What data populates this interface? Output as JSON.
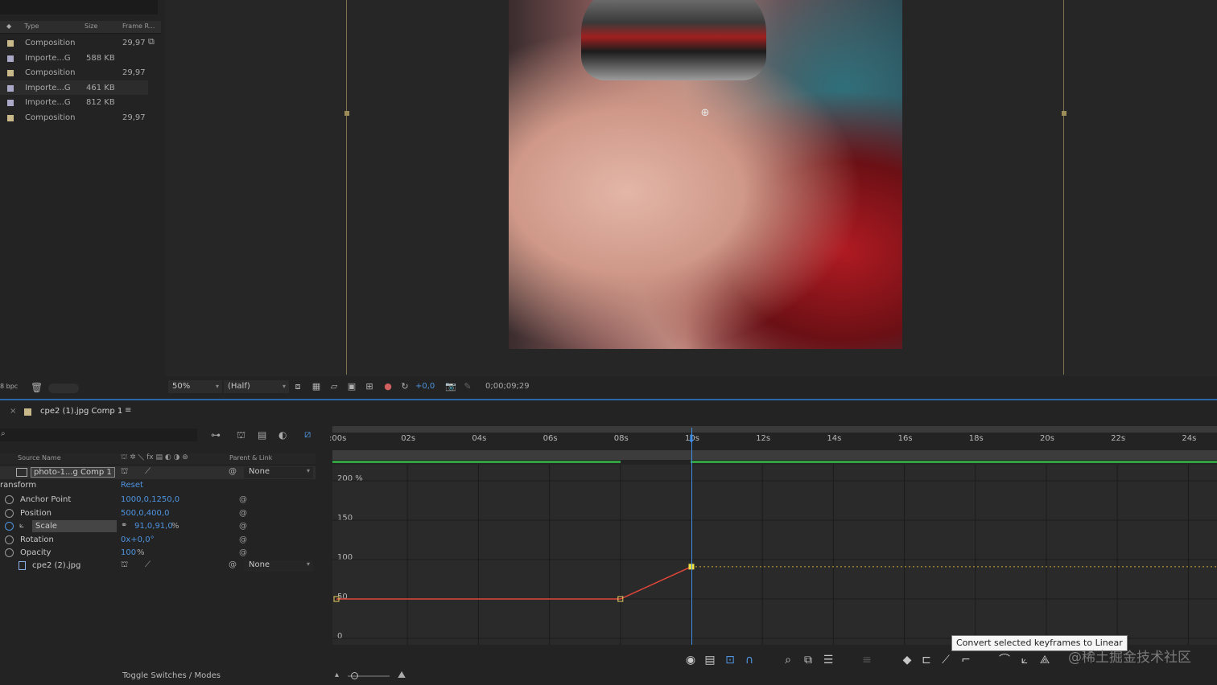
{
  "project": {
    "columns": {
      "type": "Type",
      "size": "Size",
      "frame_rate": "Frame R..."
    },
    "items": [
      {
        "type": "Composition",
        "size": "",
        "frame_rate": "29,97",
        "color": "#c8b88a"
      },
      {
        "type": "Importe...G",
        "size": "588 KB",
        "frame_rate": "",
        "color": "#a9a9c7"
      },
      {
        "type": "Composition",
        "size": "",
        "frame_rate": "29,97",
        "color": "#c8b88a"
      },
      {
        "type": "Importe...G",
        "size": "461 KB",
        "frame_rate": "",
        "color": "#a9a9c7"
      },
      {
        "type": "Importe...G",
        "size": "812 KB",
        "frame_rate": "",
        "color": "#a9a9c7"
      },
      {
        "type": "Composition",
        "size": "",
        "frame_rate": "29,97",
        "color": "#c8b88a"
      }
    ],
    "bpc": "8 bpc"
  },
  "viewer": {
    "magnification": "50%",
    "resolution": "(Half)",
    "exposure": "+0,0",
    "timecode": "0;00;09;29"
  },
  "timeline": {
    "tab_label": "cpe2 (1).jpg Comp 1",
    "columns": {
      "source_name": "Source Name",
      "parent": "Parent & Link"
    },
    "layers": [
      {
        "name": "photo-1...g Comp 1",
        "parent": "None"
      },
      {
        "name": "cpe2 (2).jpg",
        "parent": "None"
      }
    ],
    "transform": {
      "label": "ransform",
      "reset": "Reset"
    },
    "properties": [
      {
        "name": "Anchor Point",
        "value": "1000,0,1250,0"
      },
      {
        "name": "Position",
        "value": "500,0,400,0"
      },
      {
        "name": "Scale",
        "value": "91,0,91,0",
        "unit": "%"
      },
      {
        "name": "Rotation",
        "value": "0x+0,0°"
      },
      {
        "name": "Opacity",
        "value": "100",
        "unit": "%"
      }
    ],
    "ruler_ticks": [
      ":00s",
      "02s",
      "04s",
      "06s",
      "08s",
      "10s",
      "12s",
      "14s",
      "16s",
      "18s",
      "20s",
      "22s",
      "24s"
    ],
    "graph": {
      "y_labels": [
        "200 %",
        "150",
        "100",
        "50",
        "0"
      ],
      "keyframes": [
        {
          "time_s": 0,
          "value": 50
        },
        {
          "time_s": 8,
          "value": 50
        },
        {
          "time_s": 10,
          "value": 91
        }
      ],
      "current_time_s": 10,
      "y_max": 200
    },
    "toggle_label": "Toggle Switches / Modes"
  },
  "tooltip": "Convert selected keyframes to Linear",
  "watermark": "@稀土掘金技术社区",
  "colors": {
    "curve": "#e0463a",
    "keyframe_selected": "#f0e040",
    "playhead": "#3f8fe8",
    "work_area": "#35a043"
  }
}
